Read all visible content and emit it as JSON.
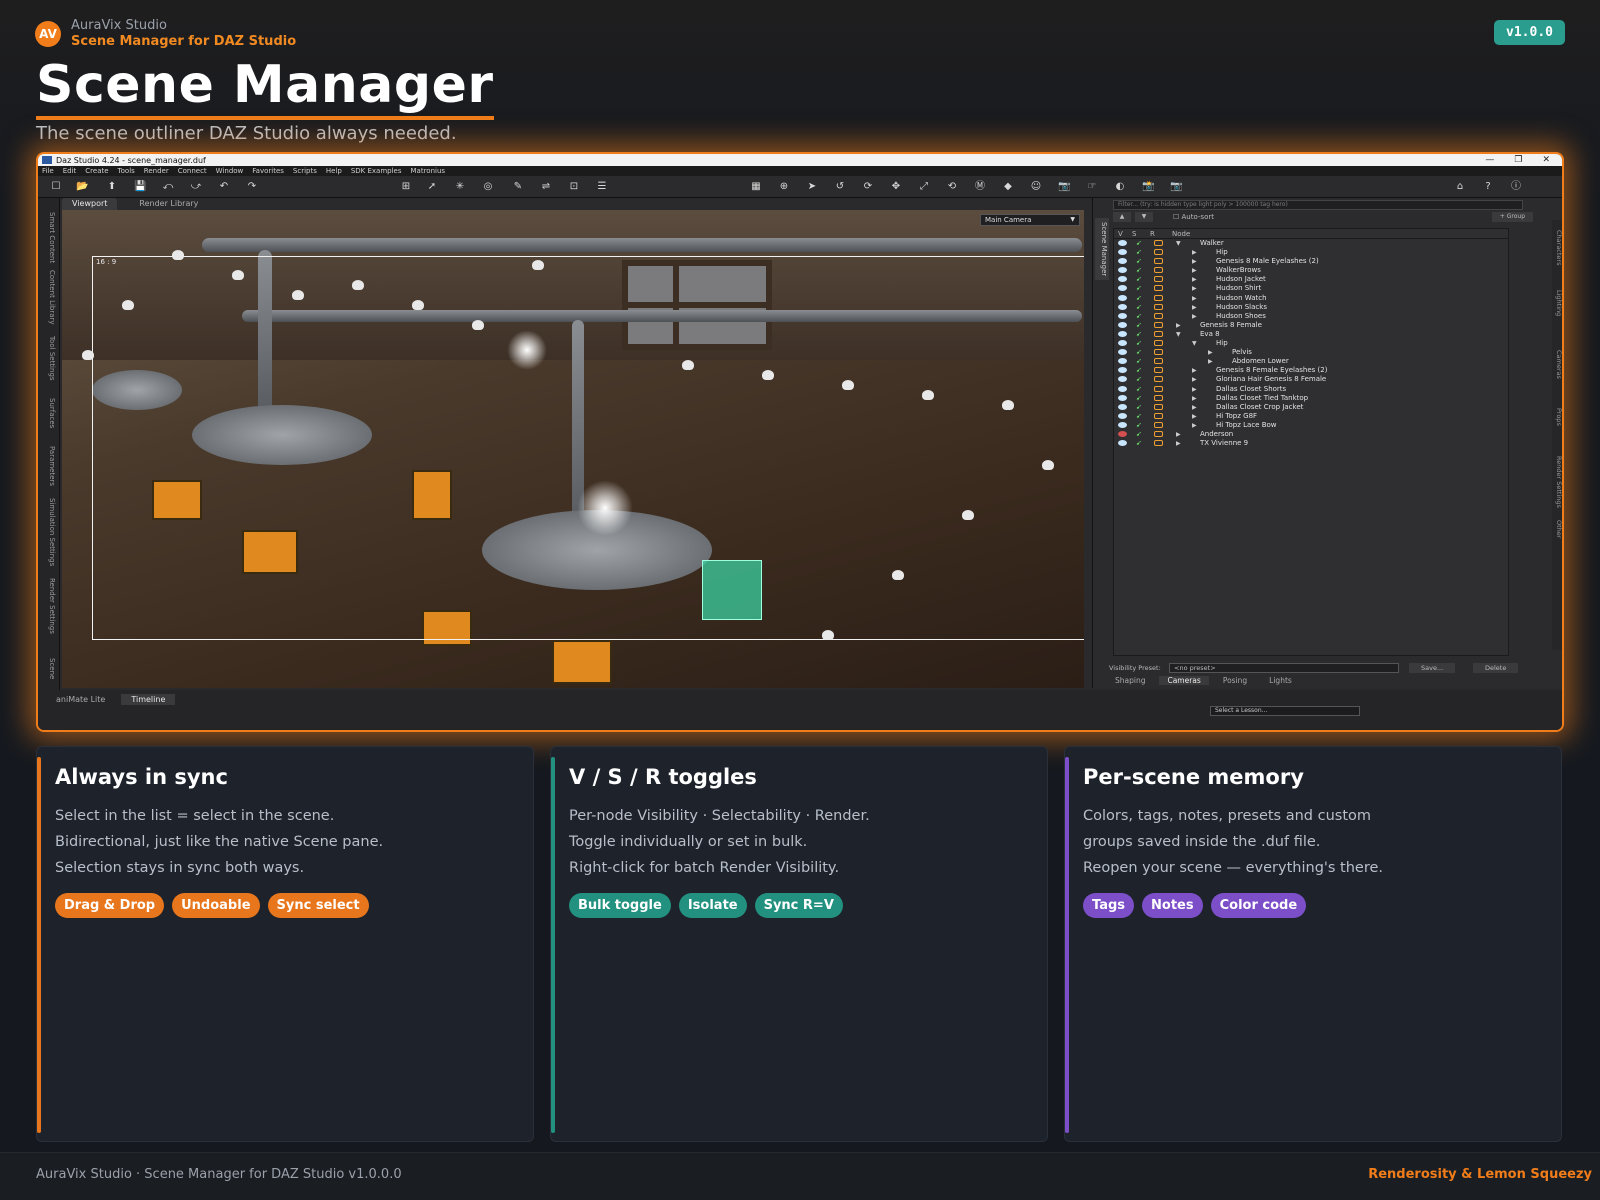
{
  "header": {
    "logo_text": "AV",
    "studio": "AuraVix Studio",
    "product": "Scene Manager for DAZ Studio",
    "version": "v1.0.0",
    "title": "Scene Manager",
    "subtitle": "The scene outliner DAZ Studio always needed."
  },
  "app": {
    "window_title": "Daz Studio 4.24 - scene_manager.duf",
    "menu": [
      "File",
      "Edit",
      "Create",
      "Tools",
      "Render",
      "Connect",
      "Window",
      "Favorites",
      "Scripts",
      "Help",
      "SDK Examples",
      "Matronius"
    ],
    "left_rail": [
      "Smart Content",
      "Content Library",
      "Tool Settings",
      "Surfaces",
      "Parameters",
      "Simulation Settings",
      "Render Settings",
      "Scene"
    ],
    "viewport_tabs": [
      "Viewport",
      "Render Library"
    ],
    "camera": "Main Camera",
    "aspect_ratio": "16 : 9",
    "bottom_tabs": [
      "aniMate Lite",
      "Timeline"
    ],
    "lesson_placeholder": "Select a Lesson...",
    "scene_manager": {
      "tab_label": "Scene Manager",
      "filter_placeholder": "Filter...  (try: is hidden  type light  poly > 100000  tag hero)",
      "autosort": "Auto-sort",
      "group_button": "+ Group",
      "columns": [
        "V",
        "S",
        "R",
        "Node"
      ],
      "nodes": [
        {
          "name": "Walker",
          "depth": 0,
          "expander": "▼",
          "hidden": false
        },
        {
          "name": "Hip",
          "depth": 1,
          "expander": "▶",
          "hidden": false
        },
        {
          "name": "Genesis 8 Male Eyelashes (2)",
          "depth": 1,
          "expander": "▶",
          "hidden": false
        },
        {
          "name": "WalkerBrows",
          "depth": 1,
          "expander": "▶",
          "hidden": false
        },
        {
          "name": "Hudson Jacket",
          "depth": 1,
          "expander": "▶",
          "hidden": false
        },
        {
          "name": "Hudson Shirt",
          "depth": 1,
          "expander": "▶",
          "hidden": false
        },
        {
          "name": "Hudson Watch",
          "depth": 1,
          "expander": "▶",
          "hidden": false
        },
        {
          "name": "Hudson Slacks",
          "depth": 1,
          "expander": "▶",
          "hidden": false
        },
        {
          "name": "Hudson Shoes",
          "depth": 1,
          "expander": "▶",
          "hidden": false
        },
        {
          "name": "Genesis 8 Female",
          "depth": 0,
          "expander": "▶",
          "hidden": false
        },
        {
          "name": "Eva 8",
          "depth": 0,
          "expander": "▼",
          "hidden": false
        },
        {
          "name": "Hip",
          "depth": 1,
          "expander": "▼",
          "hidden": false
        },
        {
          "name": "Pelvis",
          "depth": 2,
          "expander": "▶",
          "hidden": false
        },
        {
          "name": "Abdomen Lower",
          "depth": 2,
          "expander": "▶",
          "hidden": false
        },
        {
          "name": "Genesis 8 Female Eyelashes (2)",
          "depth": 1,
          "expander": "▶",
          "hidden": false
        },
        {
          "name": "Gloriana Hair Genesis 8 Female",
          "depth": 1,
          "expander": "▶",
          "hidden": false
        },
        {
          "name": "Dallas Closet Shorts",
          "depth": 1,
          "expander": "▶",
          "hidden": false
        },
        {
          "name": "Dallas Closet Tied Tanktop",
          "depth": 1,
          "expander": "▶",
          "hidden": false
        },
        {
          "name": "Dallas Closet Crop Jacket",
          "depth": 1,
          "expander": "▶",
          "hidden": false
        },
        {
          "name": "Hi Topz G8F",
          "depth": 1,
          "expander": "▶",
          "hidden": false
        },
        {
          "name": "Hi Topz Lace Bow",
          "depth": 1,
          "expander": "▶",
          "hidden": false
        },
        {
          "name": "Anderson",
          "depth": 0,
          "expander": "▶",
          "hidden": true
        },
        {
          "name": "TX Vivienne 9",
          "depth": 0,
          "expander": "▶",
          "hidden": false
        }
      ],
      "preset_label": "Visibility Preset:",
      "preset_value": "<no preset>",
      "save_button": "Save...",
      "delete_button": "Delete",
      "bottom_tabs": [
        "Shaping",
        "Cameras",
        "Posing",
        "Lights"
      ],
      "right_tabs": [
        "Characters",
        "Lighting",
        "Cameras",
        "Props",
        "Render Settings",
        "Other"
      ]
    }
  },
  "cards": [
    {
      "title": "Always in sync",
      "lines": [
        "Select in the list = select in the scene.",
        "Bidirectional, just like the native Scene pane.",
        "Selection stays in sync both ways."
      ],
      "chips": [
        "Drag & Drop",
        "Undoable",
        "Sync select"
      ],
      "accent": "#e8761c"
    },
    {
      "title": "V / S / R toggles",
      "lines": [
        "Per-node Visibility · Selectability · Render.",
        "Toggle individually or set in bulk.",
        "Right-click for batch Render Visibility."
      ],
      "chips": [
        "Bulk toggle",
        "Isolate",
        "Sync R=V"
      ],
      "accent": "#22917f"
    },
    {
      "title": "Per-scene memory",
      "lines": [
        "Colors, tags, notes, presets and custom",
        "groups saved inside the .duf file.",
        "Reopen your scene — everything's there."
      ],
      "chips": [
        "Tags",
        "Notes",
        "Color code"
      ],
      "accent": "#7c4fc9"
    }
  ],
  "footer": {
    "left": "AuraVix Studio · Scene Manager for DAZ Studio v1.0.0.0",
    "right": "Renderosity & Lemon Squeezy"
  }
}
